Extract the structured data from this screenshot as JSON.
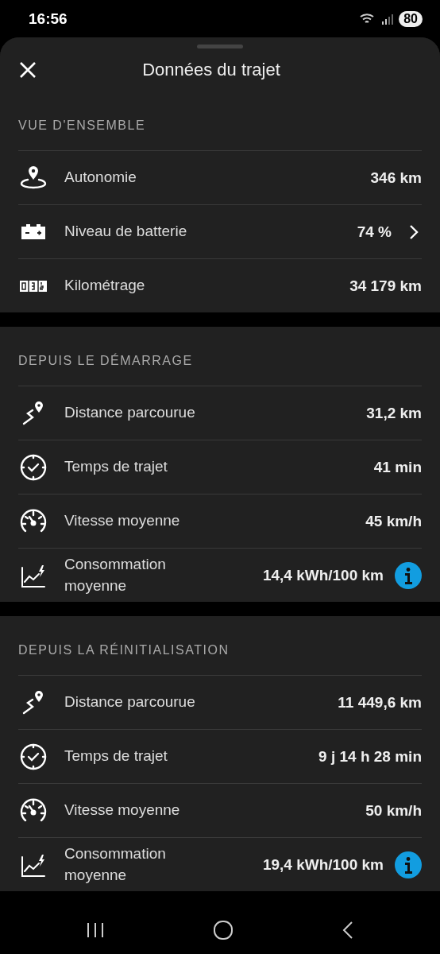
{
  "status_bar": {
    "time": "16:56",
    "battery": "80"
  },
  "sheet": {
    "title": "Données du trajet"
  },
  "sections": [
    {
      "heading": "VUE D'ENSEMBLE",
      "rows": [
        {
          "kind": "range",
          "label": "Autonomie",
          "value": "346 km",
          "chevron": false,
          "info": false
        },
        {
          "kind": "battery",
          "label": "Niveau de batterie",
          "value": "74 %",
          "chevron": true,
          "info": false
        },
        {
          "kind": "odometer",
          "label": "Kilométrage",
          "value": "34 179 km",
          "chevron": false,
          "info": false
        }
      ]
    },
    {
      "heading": "DEPUIS LE DÉMARRAGE",
      "rows": [
        {
          "kind": "distance",
          "label": "Distance parcourue",
          "value": "31,2 km",
          "chevron": false,
          "info": false
        },
        {
          "kind": "time",
          "label": "Temps de trajet",
          "value": "41 min",
          "chevron": false,
          "info": false
        },
        {
          "kind": "speed",
          "label": "Vitesse moyenne",
          "value": "45 km/h",
          "chevron": false,
          "info": false
        },
        {
          "kind": "consumption",
          "label": "Consommation moyenne",
          "value": "14,4 kWh/100 km",
          "chevron": false,
          "info": true
        }
      ]
    },
    {
      "heading": "DEPUIS LA RÉINITIALISATION",
      "rows": [
        {
          "kind": "distance",
          "label": "Distance parcourue",
          "value": "11 449,6 km",
          "chevron": false,
          "info": false
        },
        {
          "kind": "time",
          "label": "Temps de trajet",
          "value": "9 j 14 h 28 min",
          "chevron": false,
          "info": false
        },
        {
          "kind": "speed",
          "label": "Vitesse moyenne",
          "value": "50 km/h",
          "chevron": false,
          "info": false
        },
        {
          "kind": "consumption",
          "label": "Consommation moyenne",
          "value": "19,4 kWh/100 km",
          "chevron": false,
          "info": true
        }
      ]
    }
  ]
}
